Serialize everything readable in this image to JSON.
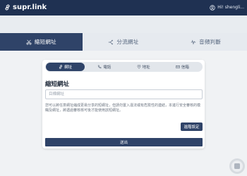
{
  "header": {
    "logo_text": "supr.link",
    "user_greeting": "Hi! shengli...",
    "logo_icon": "link-logo-icon",
    "user_icon": "user-circle-icon"
  },
  "main_tabs": [
    {
      "label": "縮短網址",
      "icon": "scissors-icon",
      "active": true
    },
    {
      "label": "分流網址",
      "icon": "split-icon",
      "active": false
    },
    {
      "label": "音頻判斷",
      "icon": "wave-icon",
      "active": false
    }
  ],
  "sub_tabs": [
    {
      "label": "網址",
      "icon": "link-icon",
      "active": true
    },
    {
      "label": "電話",
      "icon": "phone-icon",
      "active": false
    },
    {
      "label": "地址",
      "icon": "pin-icon",
      "active": false
    },
    {
      "label": "信箱",
      "icon": "mail-icon",
      "active": false
    }
  ],
  "form": {
    "title": "縮短網址",
    "input_placeholder": "目標網址",
    "input_value": "",
    "note": "您可以將任意網址縮成更易分享的短網址，但請勿置入違法或有危險性的連結，本進行安全審核的模糊及網址，將遇過審核核可後才能使用該短網址。",
    "advanced_label": "進階設定",
    "submit_label": "送出"
  },
  "colors": {
    "navy": "#1f3152",
    "accent": "#2f4368",
    "background": "#f0f2f4"
  }
}
